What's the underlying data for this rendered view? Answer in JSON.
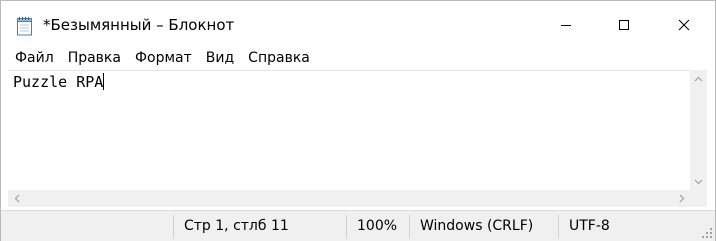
{
  "window": {
    "title": "*Безымянный – Блокнот"
  },
  "menu": {
    "items": [
      "Файл",
      "Правка",
      "Формат",
      "Вид",
      "Справка"
    ]
  },
  "editor": {
    "content": "Puzzle RPA"
  },
  "status": {
    "position": "Стр 1, стлб 11",
    "zoom": "100%",
    "line_endings": "Windows (CRLF)",
    "encoding": "UTF-8"
  },
  "icons": {
    "app": "notepad-icon",
    "minimize": "minimize-icon",
    "maximize": "maximize-icon",
    "close": "close-icon"
  }
}
